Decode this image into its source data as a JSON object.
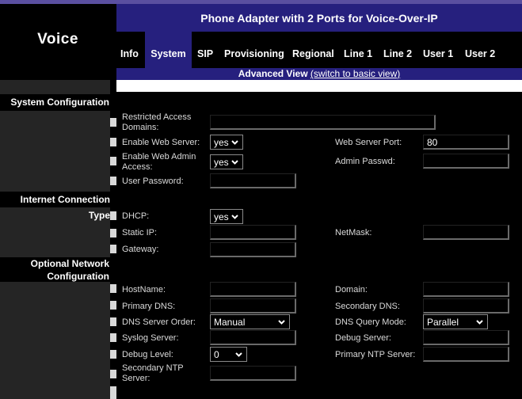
{
  "header": {
    "voice_title": "Voice",
    "product_title": "Phone Adapter with 2 Ports for Voice-Over-IP"
  },
  "tabs": [
    {
      "label": "Info"
    },
    {
      "label": "System",
      "active": true
    },
    {
      "label": "SIP"
    },
    {
      "label": "Provisioning"
    },
    {
      "label": "Regional"
    },
    {
      "label": "Line 1"
    },
    {
      "label": "Line 2"
    },
    {
      "label": "User 1"
    },
    {
      "label": "User 2"
    }
  ],
  "advanced": {
    "label": "Advanced View",
    "link_text": "(switch to basic view)"
  },
  "sections": {
    "system_config": "System Configuration",
    "internet_type": "Internet Connection Type",
    "optional_line1": "Optional Network",
    "optional_line2": "Configuration"
  },
  "system": {
    "restricted_domains_label": "Restricted Access Domains:",
    "restricted_domains_value": "",
    "enable_web_server_label": "Enable Web Server:",
    "enable_web_server_value": "yes",
    "web_server_port_label": "Web Server Port:",
    "web_server_port_value": "80",
    "enable_web_admin_label": "Enable Web Admin Access:",
    "enable_web_admin_value": "yes",
    "admin_passwd_label": "Admin Passwd:",
    "admin_passwd_value": "",
    "user_password_label": "User Password:",
    "user_password_value": ""
  },
  "internet": {
    "dhcp_label": "DHCP:",
    "dhcp_value": "yes",
    "static_ip_label": "Static IP:",
    "static_ip_value": "",
    "netmask_label": "NetMask:",
    "netmask_value": "",
    "gateway_label": "Gateway:",
    "gateway_value": ""
  },
  "optional": {
    "hostname_label": "HostName:",
    "hostname_value": "",
    "domain_label": "Domain:",
    "domain_value": "",
    "primary_dns_label": "Primary DNS:",
    "primary_dns_value": "",
    "secondary_dns_label": "Secondary DNS:",
    "secondary_dns_value": "",
    "dns_order_label": "DNS Server Order:",
    "dns_order_value": "Manual",
    "dns_query_label": "DNS Query Mode:",
    "dns_query_value": "Parallel",
    "syslog_label": "Syslog Server:",
    "syslog_value": "",
    "debug_server_label": "Debug Server:",
    "debug_server_value": "",
    "debug_level_label": "Debug Level:",
    "debug_level_value": "0",
    "primary_ntp_label": "Primary NTP Server:",
    "primary_ntp_value": "",
    "secondary_ntp_label": "Secondary NTP Server:",
    "secondary_ntp_value": ""
  },
  "colors": {
    "banner": "#26207e",
    "background": "#000000",
    "sidebar": "#252525"
  }
}
